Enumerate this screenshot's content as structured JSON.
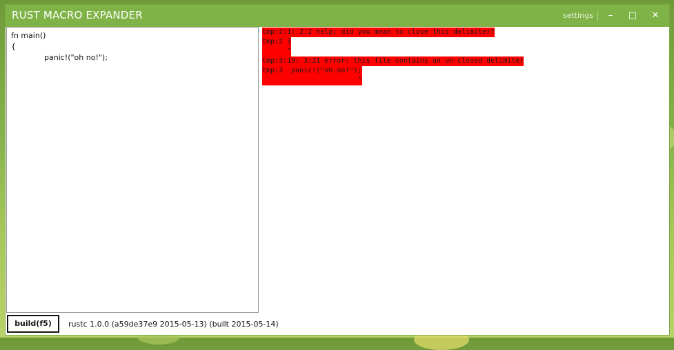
{
  "window": {
    "title": "RUST MACRO EXPANDER",
    "settings_label": "settings",
    "minimize_glyph": "–",
    "maximize_glyph": "□",
    "close_glyph": "✕"
  },
  "editor": {
    "lines": [
      "fn main()",
      "{",
      "panic!(\"oh no!\");"
    ]
  },
  "output": {
    "lines": [
      "tmp:2:1: 2:2 help: did you mean to close this delimiter?",
      "tmp:2 {",
      "      ^",
      "tmp:3:19: 3:21 error: this file contains an un-closed delimiter",
      "tmp:3  panic!(\"oh no!\");",
      "                       ^"
    ]
  },
  "footer": {
    "build_label": "build(f5)",
    "version_text": "rustc 1.0.0 (a59de37e9 2015-05-13) (built 2015-05-14)"
  },
  "colors": {
    "accent": "#7fb347",
    "error_highlight": "#ff0000"
  }
}
